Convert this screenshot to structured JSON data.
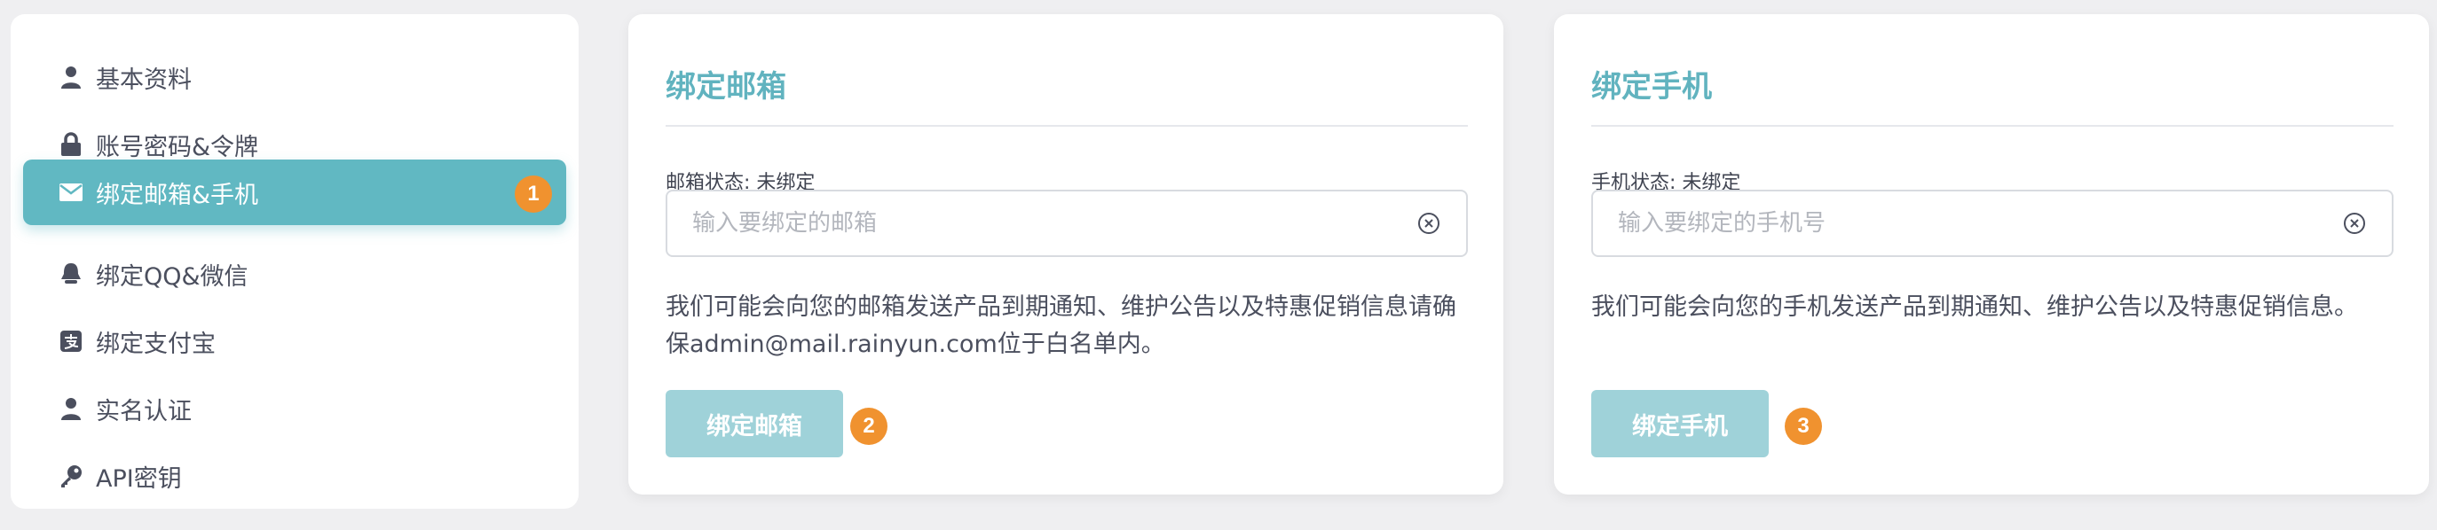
{
  "sidebar": {
    "items": [
      {
        "label": "基本资料",
        "icon": "user-icon"
      },
      {
        "label": "账号密码&令牌",
        "icon": "lock-icon"
      },
      {
        "label": "绑定邮箱&手机",
        "icon": "envelope-icon",
        "active": true,
        "badge": "1"
      },
      {
        "label": "绑定QQ&微信",
        "icon": "bell-icon"
      },
      {
        "label": "绑定支付宝",
        "icon": "alipay-icon"
      },
      {
        "label": "实名认证",
        "icon": "user-icon"
      },
      {
        "label": "API密钥",
        "icon": "key-icon"
      }
    ]
  },
  "email_card": {
    "title": "绑定邮箱",
    "status_label": "邮箱状态: 未绑定",
    "input_placeholder": "输入要绑定的邮箱",
    "description": "我们可能会向您的邮箱发送产品到期通知、维护公告以及特惠促销信息请确保admin@mail.rainyun.com位于白名单内。",
    "button_label": "绑定邮箱",
    "badge": "2"
  },
  "phone_card": {
    "title": "绑定手机",
    "status_label": "手机状态: 未绑定",
    "input_placeholder": "输入要绑定的手机号",
    "description": "我们可能会向您的手机发送产品到期通知、维护公告以及特惠促销信息。",
    "button_label": "绑定手机",
    "badge": "3"
  },
  "colors": {
    "accent": "#61b8c2",
    "button": "#9fd2d9",
    "badge": "#f0922f",
    "title": "#61b3bf"
  }
}
